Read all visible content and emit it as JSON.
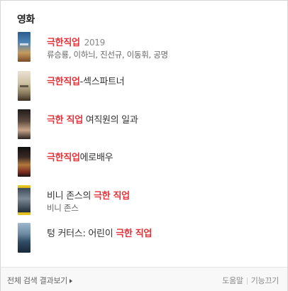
{
  "section": {
    "title": "영화"
  },
  "results": [
    {
      "pre": "",
      "highlight": "극한직업",
      "post": "",
      "year": "2019",
      "sub": "류승룡, 이하늬, 진선규, 이동휘, 공명"
    },
    {
      "pre": "",
      "highlight": "극한직업",
      "post": "-섹스파트너",
      "year": "",
      "sub": ""
    },
    {
      "pre": "",
      "highlight": "극한 직업",
      "post": " 여직원의 일과",
      "year": "",
      "sub": ""
    },
    {
      "pre": "",
      "highlight": "극한직업",
      "post": "에로배우",
      "year": "",
      "sub": ""
    },
    {
      "pre": "비니 존스의 ",
      "highlight": "극한 직업",
      "post": "",
      "year": "",
      "sub": "비니 존스"
    },
    {
      "pre": "텅 커터스: 어린이 ",
      "highlight": "극한 직업",
      "post": "",
      "year": "",
      "sub": ""
    }
  ],
  "footer": {
    "view_all": "전체 검색 결과보기",
    "help": "도움말",
    "turn_off": "기능끄기"
  },
  "colors": {
    "highlight": "#e0333a",
    "text": "#333333",
    "sub_text": "#666666",
    "footer_bg": "#f8f8f8"
  }
}
